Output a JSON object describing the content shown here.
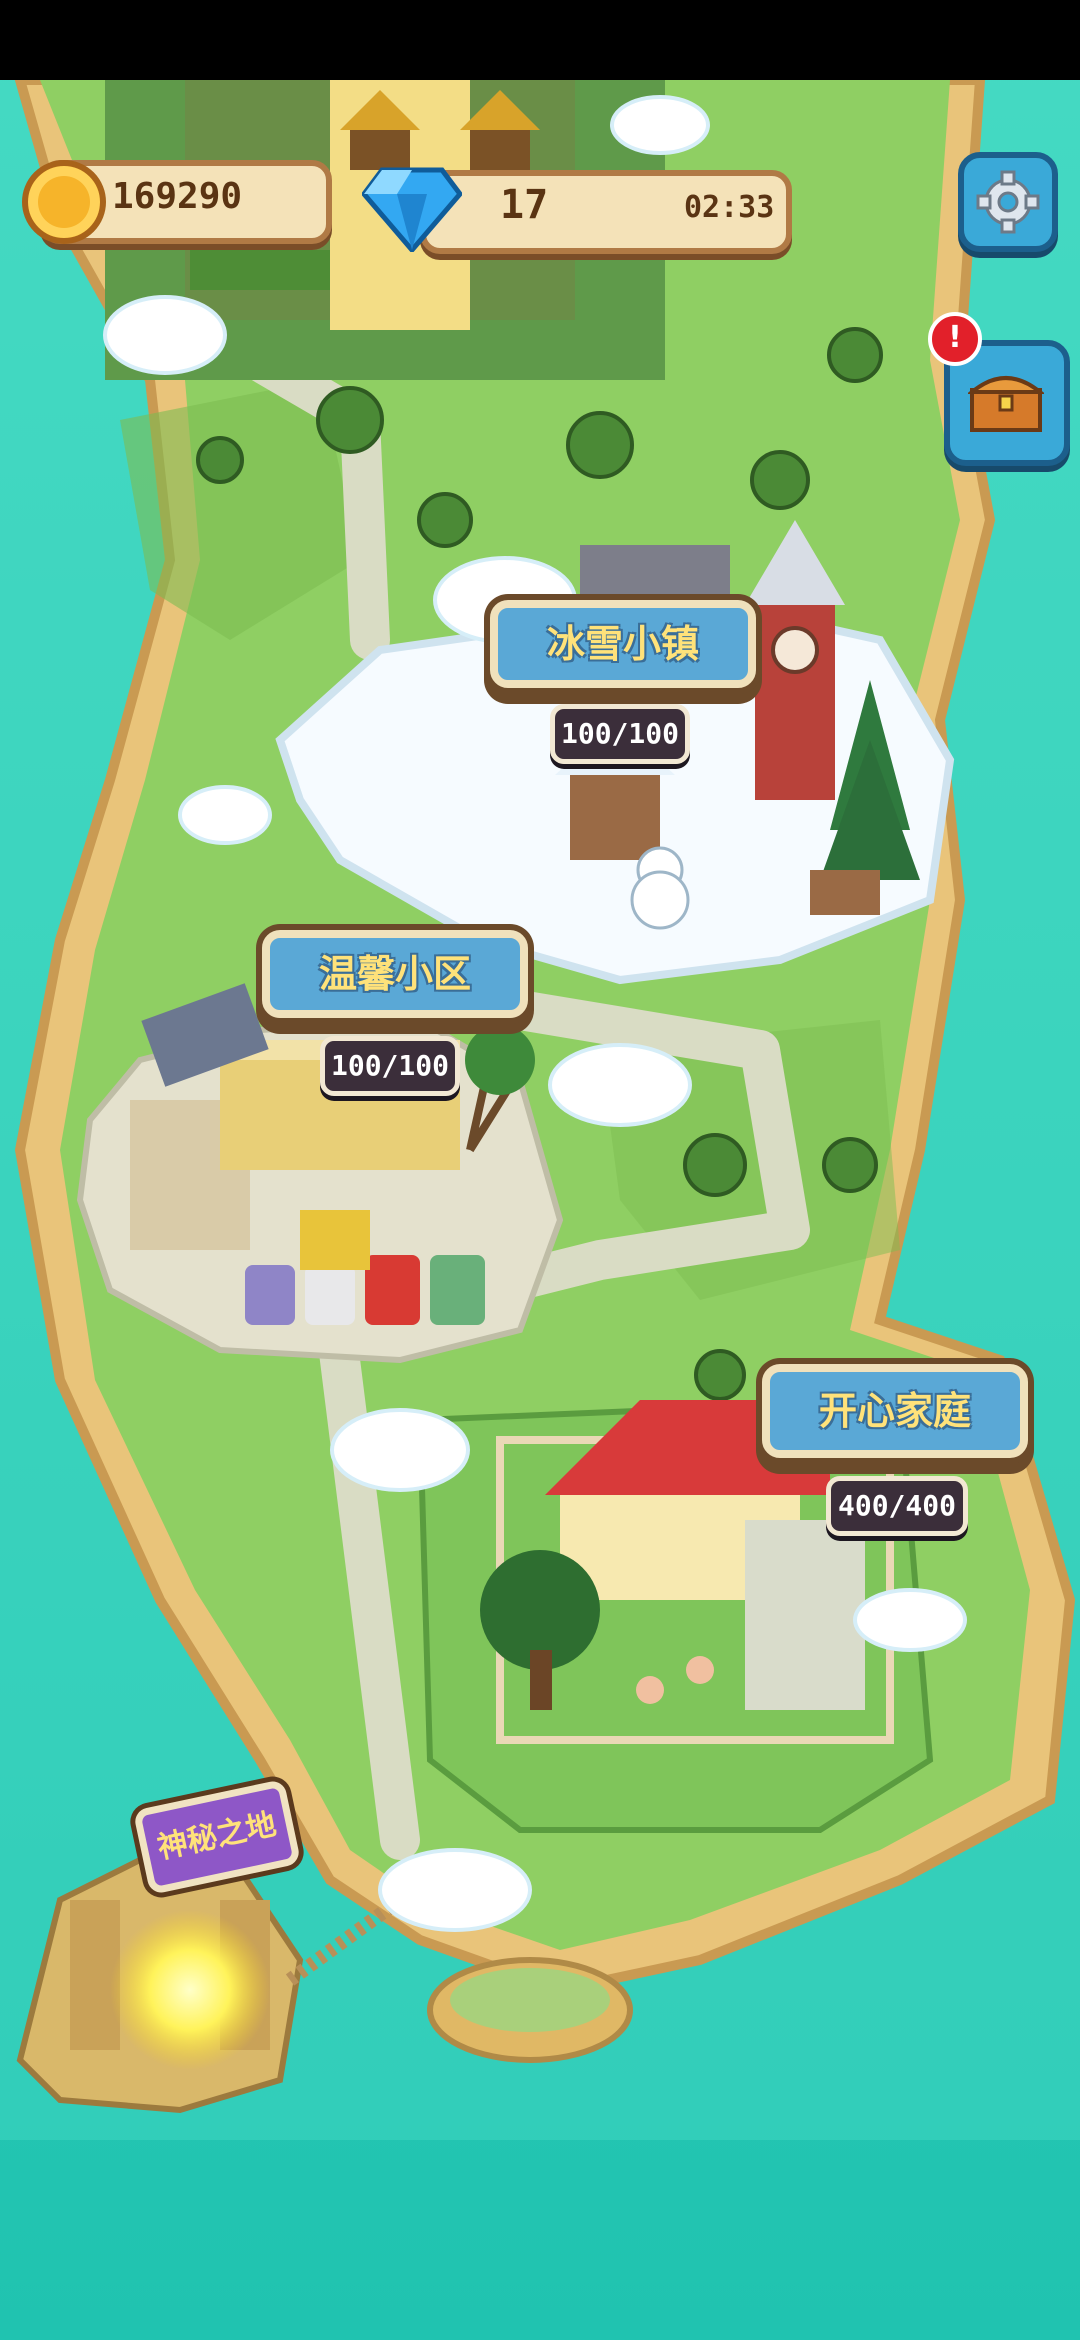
{
  "hud": {
    "coins": "169290",
    "gems": "17",
    "timer": "02:33"
  },
  "buttons": {
    "settings_icon": "gear-icon",
    "chest_icon": "treasure-chest-icon",
    "chest_alert": "!"
  },
  "areas": [
    {
      "name": "冰雪小镇",
      "progress": "100/100"
    },
    {
      "name": "温馨小区",
      "progress": "100/100"
    },
    {
      "name": "开心家庭",
      "progress": "400/400"
    }
  ],
  "secret_area": {
    "name": "神秘之地"
  },
  "colors": {
    "sea": "#2fcfb6",
    "grass": "#8fcf63",
    "sand": "#e9c47a",
    "label_blue": "#5aa8d6",
    "label_text": "#ffe27a"
  }
}
